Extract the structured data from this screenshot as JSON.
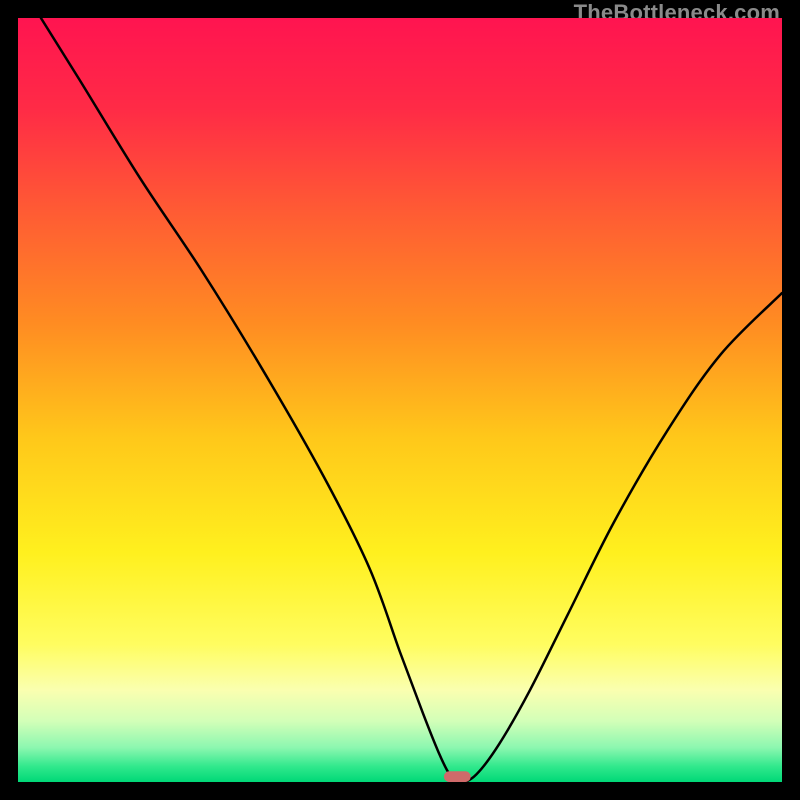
{
  "watermark": "TheBottleneck.com",
  "chart_data": {
    "type": "line",
    "title": "",
    "xlabel": "",
    "ylabel": "",
    "xlim": [
      0,
      100
    ],
    "ylim": [
      0,
      100
    ],
    "series": [
      {
        "name": "bottleneck-curve",
        "x": [
          3,
          8,
          16,
          24,
          32,
          40,
          46,
          50,
          53,
          55,
          56.5,
          58,
          60,
          63,
          67,
          72,
          78,
          85,
          92,
          100
        ],
        "values": [
          100,
          92,
          79,
          67,
          54,
          40,
          28,
          17,
          9,
          4,
          1,
          0,
          1,
          5,
          12,
          22,
          34,
          46,
          56,
          64
        ]
      }
    ],
    "marker": {
      "name": "optimal-marker",
      "x": 57.5,
      "y": 0,
      "width_pct": 3.5,
      "color": "#cf6a6a"
    },
    "background_gradient": {
      "stops": [
        {
          "pos": 0.0,
          "color": "#ff1450"
        },
        {
          "pos": 0.12,
          "color": "#ff2b46"
        },
        {
          "pos": 0.25,
          "color": "#ff5a34"
        },
        {
          "pos": 0.4,
          "color": "#ff8c22"
        },
        {
          "pos": 0.55,
          "color": "#ffc81a"
        },
        {
          "pos": 0.7,
          "color": "#fff01e"
        },
        {
          "pos": 0.82,
          "color": "#fffd60"
        },
        {
          "pos": 0.88,
          "color": "#faffb0"
        },
        {
          "pos": 0.92,
          "color": "#d3ffb8"
        },
        {
          "pos": 0.955,
          "color": "#8cf7b0"
        },
        {
          "pos": 0.98,
          "color": "#30e88c"
        },
        {
          "pos": 1.0,
          "color": "#00d877"
        }
      ]
    }
  }
}
